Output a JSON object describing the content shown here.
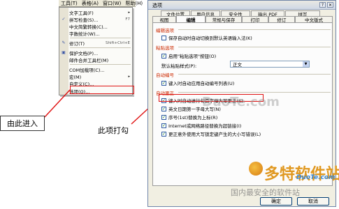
{
  "menubar": {
    "items": [
      "工具(T)",
      "表格(A)",
      "窗口(W)",
      "帮助(H)"
    ]
  },
  "menu": {
    "items": [
      {
        "label": "文字工具(F)",
        "shortcut": "",
        "arrow": "▸",
        "icon": ""
      },
      {
        "label": "拼写检查(S)...",
        "shortcut": "F7",
        "arrow": "",
        "icon": "spell-check-icon"
      },
      {
        "label": "中文简繁转换(C)...",
        "shortcut": "",
        "arrow": "",
        "icon": ""
      },
      {
        "label": "字数统计(W)...",
        "shortcut": "",
        "arrow": "",
        "icon": ""
      },
      {
        "label": "修订(T)",
        "shortcut": "Shift+Ctrl+E",
        "arrow": "",
        "icon": "track-changes-icon"
      },
      {
        "label": "保护文档(P)...",
        "shortcut": "",
        "arrow": "",
        "icon": "protect-doc-icon"
      },
      {
        "label": "邮件合并工具栏(M)",
        "shortcut": "",
        "arrow": "",
        "icon": "mail-merge-icon"
      },
      {
        "label": "COM加载项(C)...",
        "shortcut": "",
        "arrow": "",
        "icon": ""
      },
      {
        "label": "宏(M)",
        "shortcut": "",
        "arrow": "▸",
        "icon": ""
      },
      {
        "label": "自定义(C)...",
        "shortcut": "",
        "arrow": "",
        "icon": ""
      },
      {
        "label": "选项(O)...",
        "shortcut": "",
        "arrow": "",
        "icon": ""
      }
    ]
  },
  "callouts": {
    "left": "由此进入",
    "middle": "此项打勾"
  },
  "dialog": {
    "title": "选项",
    "close_label": "✕",
    "help_label": "?",
    "tabs_row1": [
      "文件位置",
      "用户信息",
      "安全性",
      "输出 PDF",
      "拼写"
    ],
    "tabs_row2": [
      "视图",
      "编辑",
      "常规与保存",
      "打印",
      "修订",
      "中文版式"
    ],
    "groups": {
      "edit": "编辑选项",
      "paste": "粘贴选项",
      "numbering": "自动编号",
      "autocorrect": "自动更正"
    },
    "edit_options": [
      {
        "label": "保存自动时自动切换到默认英语输入法(K)",
        "checked": false
      }
    ],
    "paste_options": [
      {
        "label": "启用\"粘贴选项\"按钮(O)",
        "checked": true
      }
    ],
    "paste_format_label": "默认粘贴样式(P):",
    "paste_format_value": "正文",
    "numbering_options": [
      {
        "label": "键入时自动应用自动编号列表(U)",
        "checked": true
      }
    ],
    "autocorrect_options": [
      {
        "label": "键入时自动进行句首字母大写更正(S)",
        "checked": true
      },
      {
        "label": "英文日期第一字母大写(N)",
        "checked": true
      },
      {
        "label": "序号(1st)替换为上标(R)",
        "checked": true
      },
      {
        "label": "Internet或网络路径替换为超链接(I)",
        "checked": true
      },
      {
        "label": "更正意外使用大写锁定键产生的大小写错误(L)",
        "checked": true
      }
    ],
    "ok_label": "确定",
    "cancel_label": "取消"
  },
  "watermarks": {
    "url": "DuoTe.com",
    "brand": "多特软件站",
    "site": "DuoTe.com",
    "slogan": "国内最安全的软件站"
  },
  "colors": {
    "callout_red": "#e01010",
    "group_label": "#cc2a00"
  }
}
